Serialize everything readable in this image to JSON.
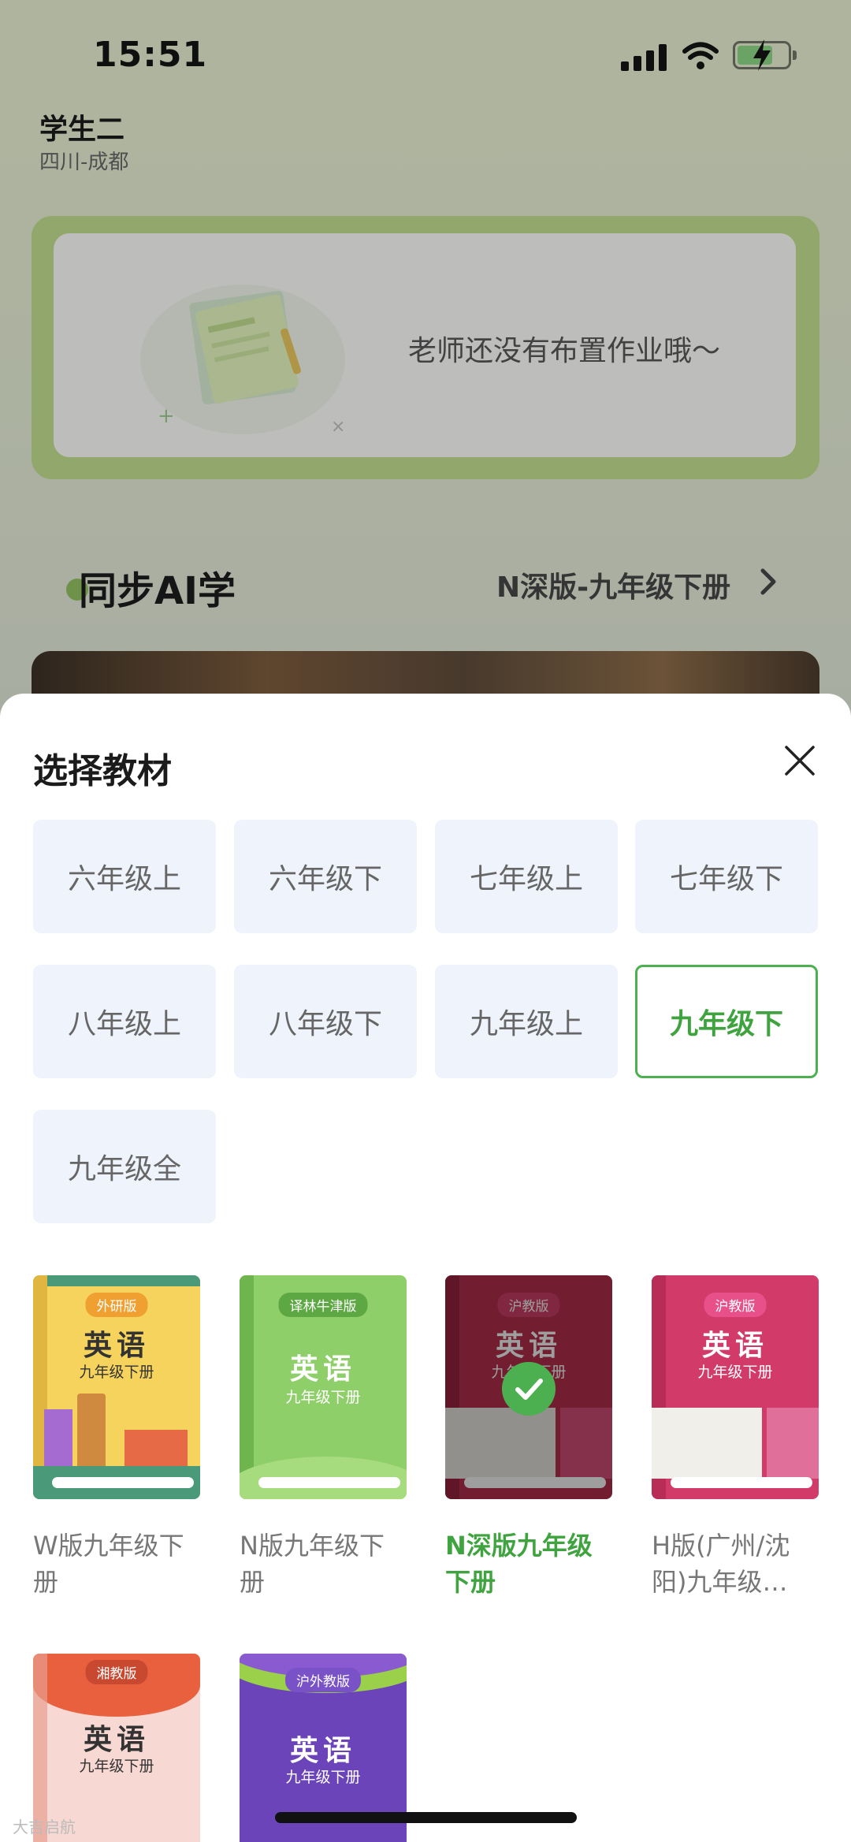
{
  "status_bar": {
    "time": "15:51"
  },
  "user": {
    "name": "学生二",
    "location": "四川-成都"
  },
  "homework": {
    "empty_text": "老师还没有布置作业哦～"
  },
  "sync": {
    "title": "同步AI学",
    "current_book": "N深版-九年级下册"
  },
  "sheet": {
    "title": "选择教材",
    "grades": [
      {
        "label": "六年级上",
        "selected": false
      },
      {
        "label": "六年级下",
        "selected": false
      },
      {
        "label": "七年级上",
        "selected": false
      },
      {
        "label": "七年级下",
        "selected": false
      },
      {
        "label": "八年级上",
        "selected": false
      },
      {
        "label": "八年级下",
        "selected": false
      },
      {
        "label": "九年级上",
        "selected": false
      },
      {
        "label": "九年级下",
        "selected": true
      },
      {
        "label": "九年级全",
        "selected": false
      }
    ],
    "books": [
      {
        "label": "W版九年级下册",
        "label_lines": [
          "W版九年级下",
          "册"
        ],
        "publisher": "外研版",
        "subject": "英语",
        "grade": "九年级下册",
        "selected": false
      },
      {
        "label": "N版九年级下册",
        "label_lines": [
          "N版九年级下",
          "册"
        ],
        "publisher": "译林牛津版",
        "subject": "英语",
        "grade": "九年级下册",
        "selected": false
      },
      {
        "label": "N深版九年级下册",
        "label_lines": [
          "N深版九年级",
          "下册"
        ],
        "publisher": "沪教版",
        "subject": "英语",
        "grade": "九年级下册",
        "selected": true
      },
      {
        "label": "H版(广州/沈阳)九年级…",
        "label_lines": [
          "H版(广州/沈",
          "阳)九年级…"
        ],
        "publisher": "沪教版",
        "subject": "英语",
        "grade": "九年级下册",
        "selected": false
      },
      {
        "label": "",
        "label_lines": [],
        "publisher": "湘教版",
        "subject": "英语",
        "grade": "九年级下册",
        "selected": false
      },
      {
        "label": "",
        "label_lines": [],
        "publisher": "沪外教版",
        "subject": "英语",
        "grade": "九年级下册",
        "selected": false
      }
    ]
  },
  "watermark": "大吉启航",
  "colors": {
    "accent": "#4caf50",
    "grade_bg": "#eff3fc",
    "homework_card": "#bcd68a"
  }
}
